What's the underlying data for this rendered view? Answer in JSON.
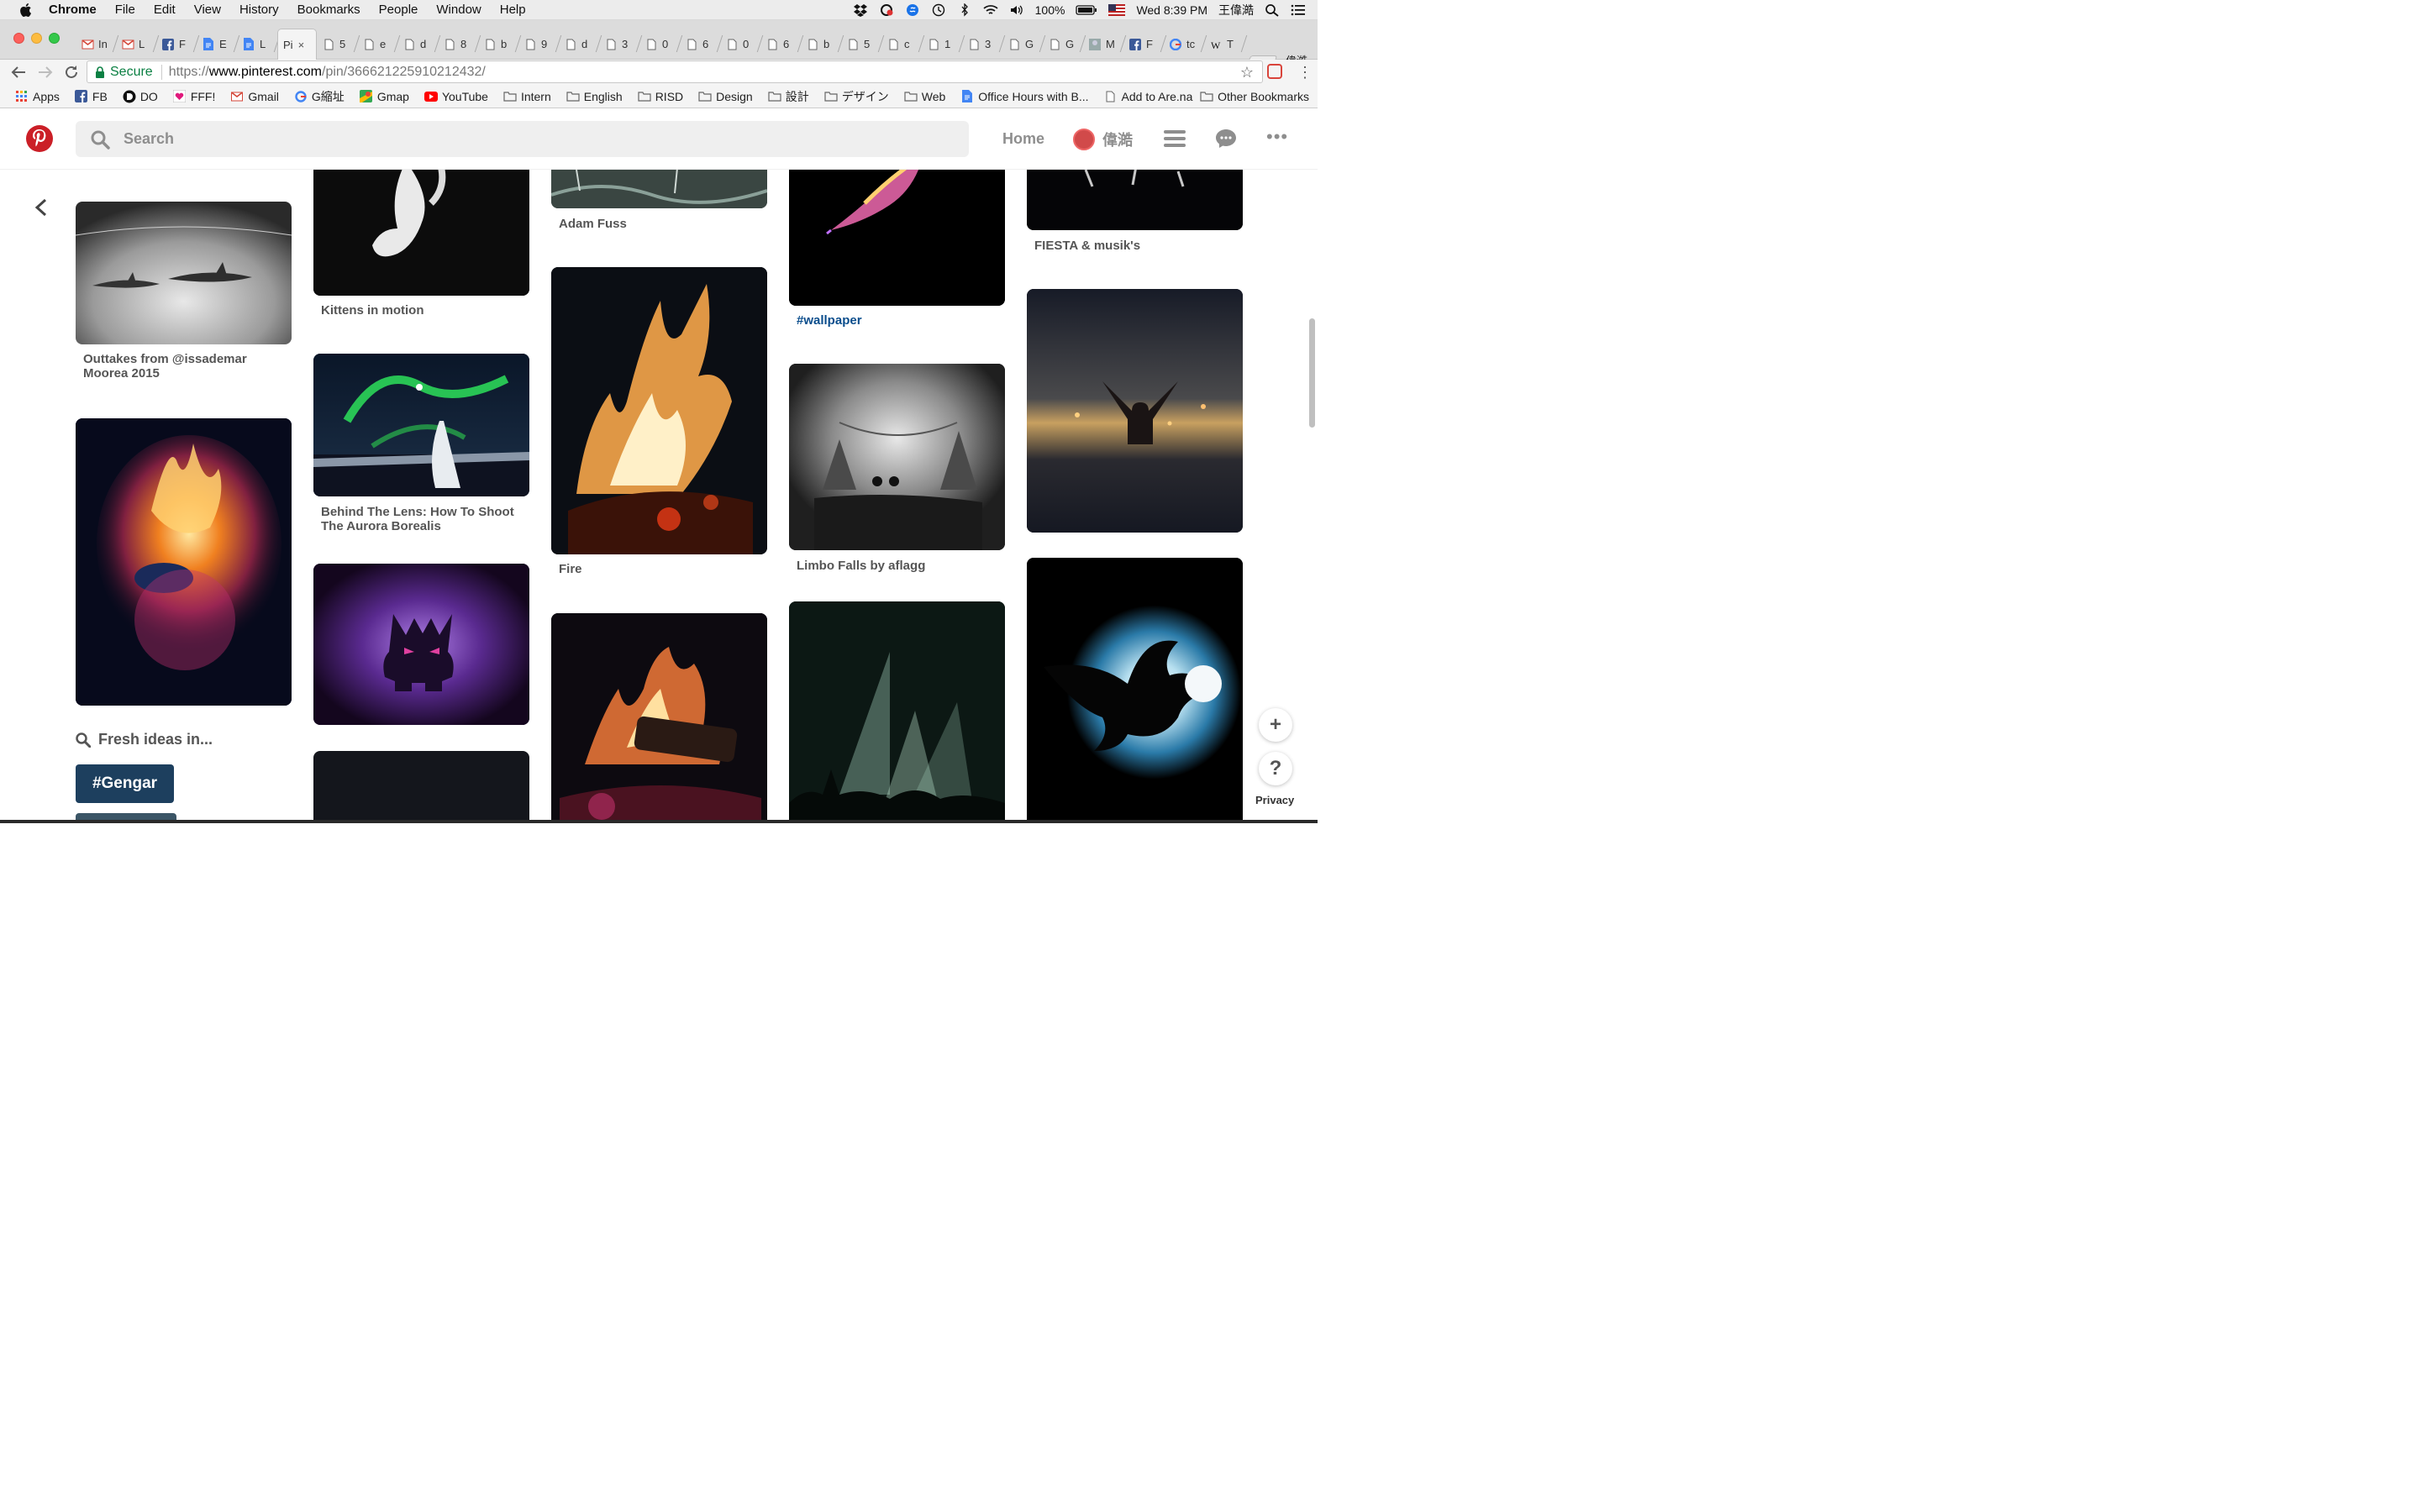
{
  "menubar": {
    "app": "Chrome",
    "items": [
      "File",
      "Edit",
      "View",
      "History",
      "Bookmarks",
      "People",
      "Window",
      "Help"
    ],
    "battery": "100%",
    "datetime": "Wed 8:39 PM",
    "user": "王偉澔"
  },
  "tabs": {
    "items": [
      {
        "icon": "gmail-icon",
        "label": "In"
      },
      {
        "icon": "gmail-icon",
        "label": "L"
      },
      {
        "icon": "facebook-icon",
        "label": "F"
      },
      {
        "icon": "docs-icon",
        "label": "E"
      },
      {
        "icon": "docs-icon",
        "label": "L"
      },
      {
        "icon": "pinterest-icon",
        "label": "Pi"
      },
      {
        "icon": "page-icon",
        "label": "5"
      },
      {
        "icon": "page-icon",
        "label": "e"
      },
      {
        "icon": "page-icon",
        "label": "d"
      },
      {
        "icon": "page-icon",
        "label": "8"
      },
      {
        "icon": "page-icon",
        "label": "b"
      },
      {
        "icon": "page-icon",
        "label": "9"
      },
      {
        "icon": "page-icon",
        "label": "d"
      },
      {
        "icon": "page-icon",
        "label": "3"
      },
      {
        "icon": "page-icon",
        "label": "0"
      },
      {
        "icon": "page-icon",
        "label": "6"
      },
      {
        "icon": "page-icon",
        "label": "0"
      },
      {
        "icon": "page-icon",
        "label": "6"
      },
      {
        "icon": "page-icon",
        "label": "b"
      },
      {
        "icon": "page-icon",
        "label": "5"
      },
      {
        "icon": "page-icon",
        "label": "c"
      },
      {
        "icon": "page-icon",
        "label": "1"
      },
      {
        "icon": "page-icon",
        "label": "3"
      },
      {
        "icon": "page-icon",
        "label": "G"
      },
      {
        "icon": "page-icon",
        "label": "G"
      },
      {
        "icon": "image-icon",
        "label": "M"
      },
      {
        "icon": "facebook-icon",
        "label": "F"
      },
      {
        "icon": "google-icon",
        "label": "tc"
      },
      {
        "icon": "wikipedia-icon",
        "label": "T"
      }
    ],
    "close_glyph": "×",
    "profile": "偉澔"
  },
  "omnibox": {
    "secure_label": "Secure",
    "url_scheme": "https://",
    "url_host": "www.pinterest.com",
    "url_path": "/pin/366621225910212432/"
  },
  "bookmarks": {
    "items": [
      {
        "icon": "apps-icon",
        "label": "Apps"
      },
      {
        "icon": "facebook-icon",
        "label": "FB"
      },
      {
        "icon": "do-icon",
        "label": "DO"
      },
      {
        "icon": "heart-icon",
        "label": "FFF!"
      },
      {
        "icon": "gmail-icon",
        "label": "Gmail"
      },
      {
        "icon": "google-icon",
        "label": "G縮址"
      },
      {
        "icon": "maps-icon",
        "label": "Gmap"
      },
      {
        "icon": "youtube-icon",
        "label": "YouTube"
      },
      {
        "icon": "folder-icon",
        "label": "Intern"
      },
      {
        "icon": "folder-icon",
        "label": "English"
      },
      {
        "icon": "folder-icon",
        "label": "RISD"
      },
      {
        "icon": "folder-icon",
        "label": "Design"
      },
      {
        "icon": "folder-icon",
        "label": "設計"
      },
      {
        "icon": "folder-icon",
        "label": "デザイン"
      },
      {
        "icon": "folder-icon",
        "label": "Web"
      },
      {
        "icon": "docs-icon",
        "label": "Office Hours with B..."
      },
      {
        "icon": "page-icon",
        "label": "Add to Are.na"
      }
    ],
    "other": "Other Bookmarks"
  },
  "pinterest": {
    "search_placeholder": "Search",
    "home": "Home",
    "username": "偉澔",
    "fresh_ideas": "Fresh ideas in...",
    "tag": "#Gengar",
    "privacy": "Privacy",
    "plus": "+",
    "help": "?"
  },
  "pins": {
    "c1a": "Outtakes from @issademar Moorea 2015",
    "c2a": "Kittens in motion",
    "c2b": "Behind The Lens: How To Shoot The Aurora Borealis",
    "c3a": "Adam Fuss",
    "c3b": "Fire",
    "c4a": "#wallpaper",
    "c4b": "Limbo Falls by aflagg",
    "c5a": "FIESTA & musik's"
  },
  "colors": {
    "pinterest_red": "#cb1f27",
    "tag_blue": "#1d3f5e",
    "link_blue": "#0a4d8c",
    "secure_green": "#0b8043"
  }
}
